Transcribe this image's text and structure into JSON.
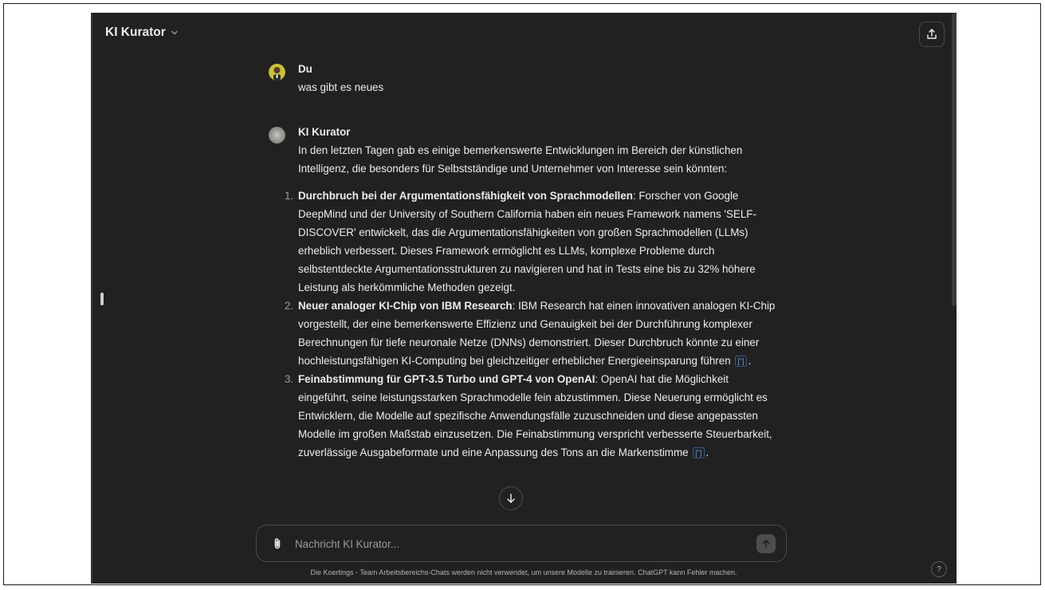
{
  "header": {
    "title": "KI Kurator",
    "title_chevron": "⌄",
    "share_icon": "share-icon"
  },
  "conversation": {
    "user_message": {
      "sender": "Du",
      "text": "was gibt es neues"
    },
    "bot_message": {
      "sender": "KI Kurator",
      "intro": "In den letzten Tagen gab es einige bemerkenswerte Entwicklungen im Bereich der künstlichen Intelligenz, die besonders für Selbstständige und Unternehmer von Interesse sein könnten:",
      "items": [
        {
          "number": "1.",
          "heading": "Durchbruch bei der Argumentationsfähigkeit von Sprachmodellen",
          "text": ": Forscher von Google DeepMind und der University of Southern California haben ein neues Framework namens 'SELF-DISCOVER' entwickelt, das die Argumentationsfähigkeiten von großen Sprachmodellen (LLMs) erheblich verbessert. Dieses Framework ermöglicht es LLMs, komplexe Probleme durch selbstentdeckte Argumentationsstrukturen zu navigieren und hat in Tests eine bis zu 32% höhere Leistung als herkömmliche Methoden gezeigt.",
          "citation": ""
        },
        {
          "number": "2.",
          "heading": "Neuer analoger KI-Chip von IBM Research",
          "text": ": IBM Research hat einen innovativen analogen KI-Chip vorgestellt, der eine bemerkenswerte Effizienz und Genauigkeit bei der Durchführung komplexer Berechnungen für tiefe neuronale Netze (DNNs) demonstriert. Dieser Durchbruch könnte zu einer hochleistungsfähigen KI-Computing bei gleichzeitiger erheblicher Energieeinsparung führen",
          "citation": "[\"]",
          "tail": "."
        },
        {
          "number": "3.",
          "heading": "Feinabstimmung für GPT-3.5 Turbo und GPT-4 von OpenAI",
          "text": ": OpenAI hat die Möglichkeit eingeführt, seine leistungsstarken Sprachmodelle fein abzustimmen. Diese Neuerung ermöglicht es Entwicklern, die Modelle auf spezifische Anwendungsfälle zuzuschneiden und diese angepassten Modelle im großen Maßstab einzusetzen. Die Feinabstimmung verspricht verbesserte Steuerbarkeit, zuverlässige Ausgabeformate und eine Anpassung des Tons an die Markenstimme",
          "citation": "[\"]",
          "tail": "."
        }
      ]
    }
  },
  "composer": {
    "placeholder": "Nachricht KI Kurator...",
    "attach_icon": "paperclip-icon",
    "send_icon": "arrow-up-icon"
  },
  "footer": {
    "note": "Die Koertings - Team Arbeitsbereichs-Chats werden nicht verwendet, um unsere Modelle zu trainieren. ChatGPT kann Fehler machen.",
    "help_label": "?"
  }
}
